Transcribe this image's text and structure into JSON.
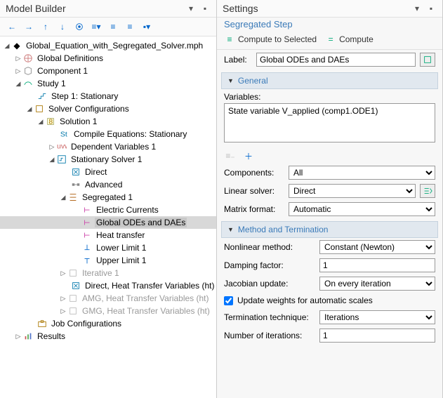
{
  "left_panel": {
    "title": "Model Builder"
  },
  "tree": {
    "root": "Global_Equation_with_Segregated_Solver.mph",
    "globdef": "Global Definitions",
    "comp1": "Component 1",
    "study1": "Study 1",
    "step1": "Step 1: Stationary",
    "solverconf": "Solver Configurations",
    "sol1": "Solution 1",
    "compileeq": "Compile Equations: Stationary",
    "depvar": "Dependent Variables 1",
    "statsolver": "Stationary Solver 1",
    "direct": "Direct",
    "advanced": "Advanced",
    "seg1": "Segregated 1",
    "seg_ec": "Electric Currents",
    "seg_ode": "Global ODEs and DAEs",
    "seg_ht": "Heat transfer",
    "seg_ll": "Lower Limit 1",
    "seg_ul": "Upper Limit 1",
    "iter1": "Iterative 1",
    "direct_ht": "Direct, Heat Transfer Variables (ht)",
    "amg_ht": "AMG, Heat Transfer Variables (ht)",
    "gmg_ht": "GMG, Heat Transfer Variables (ht)",
    "jobconf": "Job Configurations",
    "results": "Results"
  },
  "right_panel": {
    "title": "Settings",
    "subtitle": "Segregated Step"
  },
  "actions": {
    "compute_sel": "Compute to Selected",
    "compute": "Compute"
  },
  "label_field": {
    "label": "Label:",
    "value": "Global ODEs and DAEs"
  },
  "sections": {
    "general": "General",
    "method": "Method and Termination"
  },
  "general": {
    "vars_label": "Variables:",
    "vars_text": "State variable V_applied (comp1.ODE1)",
    "components_label": "Components:",
    "components_value": "All",
    "linsolver_label": "Linear solver:",
    "linsolver_value": "Direct",
    "matrix_label": "Matrix format:",
    "matrix_value": "Automatic"
  },
  "method": {
    "nonlin_label": "Nonlinear method:",
    "nonlin_value": "Constant (Newton)",
    "damp_label": "Damping factor:",
    "damp_value": "1",
    "jac_label": "Jacobian update:",
    "jac_value": "On every iteration",
    "weights_label": "Update weights for automatic scales",
    "term_label": "Termination technique:",
    "term_value": "Iterations",
    "niter_label": "Number of iterations:",
    "niter_value": "1"
  }
}
